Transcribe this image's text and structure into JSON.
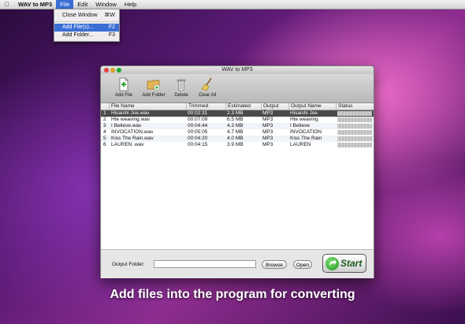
{
  "menubar": {
    "app_name": "WAV to MP3",
    "items": [
      "File",
      "Edit",
      "Window",
      "Help"
    ]
  },
  "file_menu": {
    "items": [
      {
        "label": "Close Window",
        "shortcut": "⌘W"
      },
      {
        "label": "Add File(s)...",
        "shortcut": "F2"
      },
      {
        "label": "Add Folder...",
        "shortcut": "F3"
      }
    ]
  },
  "window": {
    "title": "WAV to MP3"
  },
  "toolbar": {
    "add_file": "Add File",
    "add_folder": "Add Folder",
    "delete": "Delete",
    "clear_all": "Clear All"
  },
  "table": {
    "columns": [
      "File Name",
      "Trimmed Length",
      "Estimated Size",
      "Output Type",
      "Output Name",
      "Status"
    ],
    "rows": [
      {
        "num": "1",
        "file": "Hisaishi Joe.wav",
        "length": "00:02:31",
        "size": "2.3 MB",
        "type": "MP3",
        "name": "Hisaishi Joe"
      },
      {
        "num": "2",
        "file": "Hte weaving.wav",
        "length": "00:07:09",
        "size": "6.5 MB",
        "type": "MP3",
        "name": "Hte weaving"
      },
      {
        "num": "3",
        "file": "I Believe.wav",
        "length": "00:04:44",
        "size": "4.3 MB",
        "type": "MP3",
        "name": "I Believe"
      },
      {
        "num": "4",
        "file": "INVOCATION.wav",
        "length": "00:05:05",
        "size": "4.7 MB",
        "type": "MP3",
        "name": "INVOCATION"
      },
      {
        "num": "5",
        "file": "Kiss The Rain.wav",
        "length": "00:04:20",
        "size": "4.0 MB",
        "type": "MP3",
        "name": "Kiss The Rain"
      },
      {
        "num": "6",
        "file": "LAUREN .wav",
        "length": "00:04:15",
        "size": "3.9 MB",
        "type": "MP3",
        "name": "LAUREN"
      }
    ]
  },
  "bottom": {
    "output_folder_label": "Output Folder:",
    "output_folder_value": "",
    "browse": "Browse",
    "open": "Open",
    "start": "Start"
  },
  "caption": "Add files into the program for converting",
  "colors": {
    "menu_highlight": "#3b6fd6",
    "selected_row": "#4a4a4a",
    "start_green": "#1f8f24"
  }
}
